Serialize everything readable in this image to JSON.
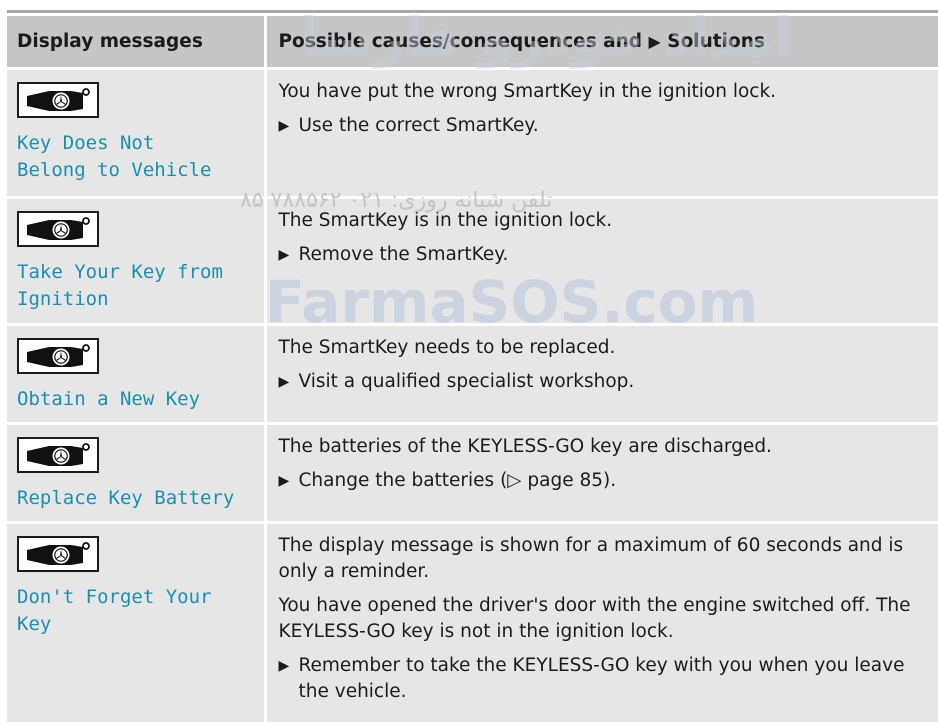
{
  "header": {
    "col1": "Display messages",
    "col2_prefix": "Possible causes/consequences and ",
    "col2_arrow": "▶",
    "col2_suffix": " Solutions"
  },
  "watermarks": {
    "persian_logo": "امداد خودرو فارسا",
    "phone": "تلفن شبانه روزی: ۰۲۱ ۷۸۸۵۶۲ ۸۵",
    "site": "FarmaSOS.com"
  },
  "icons": {
    "key": "smartkey-icon",
    "bullet": "triangle-right"
  },
  "rows": [
    {
      "message": "Key Does Not\nBelong to Vehicle",
      "paragraphs": [
        "You have put the wrong SmartKey in the ignition lock."
      ],
      "steps": [
        "Use the correct SmartKey."
      ]
    },
    {
      "message": "Take Your Key from\nIgnition",
      "paragraphs": [
        "The SmartKey is in the ignition lock."
      ],
      "steps": [
        "Remove the SmartKey."
      ]
    },
    {
      "message": "Obtain a New Key",
      "paragraphs": [
        "The SmartKey needs to be replaced."
      ],
      "steps": [
        "Visit a qualified specialist workshop."
      ]
    },
    {
      "message": "Replace Key Battery",
      "paragraphs": [
        "The batteries of the KEYLESS-GO key are discharged."
      ],
      "steps": [
        "Change the batteries (▷ page 85)."
      ]
    },
    {
      "message": "Don't Forget Your\nKey",
      "paragraphs": [
        "The display message is shown for a maximum of 60 seconds and is only a reminder.",
        "You have opened the driver's door with the engine switched off. The KEYLESS-GO key is not in the ignition lock."
      ],
      "steps": [
        "Remember to take the KEYLESS-GO key with you when you leave the vehicle."
      ]
    }
  ]
}
